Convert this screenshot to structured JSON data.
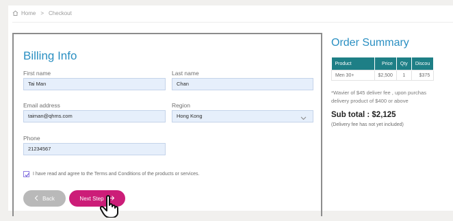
{
  "breadcrumb": {
    "home": "Home",
    "separator": ">",
    "current": "Checkout"
  },
  "billing": {
    "title": "Billing Info",
    "first_name": {
      "label": "First name",
      "value": "Tai Man"
    },
    "last_name": {
      "label": "Last name",
      "value": "Chan"
    },
    "email": {
      "label": "Email address",
      "value": "taiman@qhms.com"
    },
    "region": {
      "label": "Region",
      "value": "Hong Kong"
    },
    "phone": {
      "label": "Phone",
      "value": "21234567"
    },
    "agree_text": "I have read and agree to the Terms and Conditions of the products or services.",
    "agree_checked": true,
    "back_label": "Back",
    "next_label": "Next Step"
  },
  "summary": {
    "title": "Order Summary",
    "columns": [
      "Product",
      "Price",
      "Qty",
      "Discou"
    ],
    "rows": [
      [
        "Men 30+",
        "$2,500",
        "1",
        "$375"
      ]
    ],
    "note_line1": "*Wavier of $45 deliver fee , upon purchas",
    "note_line2": "delivery product of $400 or above",
    "subtotal": "Sub total : $2,125",
    "delivery_note": "(Delivery fee has not yet included)"
  },
  "colors": {
    "accent": "#2a8fc2",
    "primary_button": "#cc1d78",
    "table_header": "#1e7f86"
  }
}
